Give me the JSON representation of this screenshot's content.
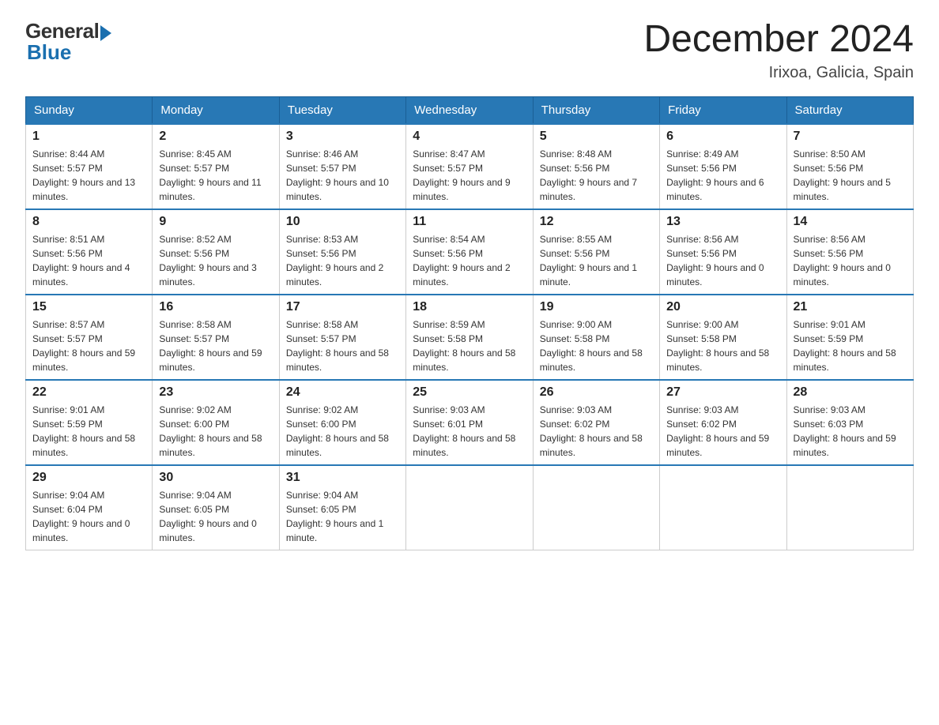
{
  "header": {
    "logo_general": "General",
    "logo_blue": "Blue",
    "main_title": "December 2024",
    "subtitle": "Irixoa, Galicia, Spain"
  },
  "days_of_week": [
    "Sunday",
    "Monday",
    "Tuesday",
    "Wednesday",
    "Thursday",
    "Friday",
    "Saturday"
  ],
  "weeks": [
    [
      {
        "day": "1",
        "sunrise": "8:44 AM",
        "sunset": "5:57 PM",
        "daylight": "9 hours and 13 minutes."
      },
      {
        "day": "2",
        "sunrise": "8:45 AM",
        "sunset": "5:57 PM",
        "daylight": "9 hours and 11 minutes."
      },
      {
        "day": "3",
        "sunrise": "8:46 AM",
        "sunset": "5:57 PM",
        "daylight": "9 hours and 10 minutes."
      },
      {
        "day": "4",
        "sunrise": "8:47 AM",
        "sunset": "5:57 PM",
        "daylight": "9 hours and 9 minutes."
      },
      {
        "day": "5",
        "sunrise": "8:48 AM",
        "sunset": "5:56 PM",
        "daylight": "9 hours and 7 minutes."
      },
      {
        "day": "6",
        "sunrise": "8:49 AM",
        "sunset": "5:56 PM",
        "daylight": "9 hours and 6 minutes."
      },
      {
        "day": "7",
        "sunrise": "8:50 AM",
        "sunset": "5:56 PM",
        "daylight": "9 hours and 5 minutes."
      }
    ],
    [
      {
        "day": "8",
        "sunrise": "8:51 AM",
        "sunset": "5:56 PM",
        "daylight": "9 hours and 4 minutes."
      },
      {
        "day": "9",
        "sunrise": "8:52 AM",
        "sunset": "5:56 PM",
        "daylight": "9 hours and 3 minutes."
      },
      {
        "day": "10",
        "sunrise": "8:53 AM",
        "sunset": "5:56 PM",
        "daylight": "9 hours and 2 minutes."
      },
      {
        "day": "11",
        "sunrise": "8:54 AM",
        "sunset": "5:56 PM",
        "daylight": "9 hours and 2 minutes."
      },
      {
        "day": "12",
        "sunrise": "8:55 AM",
        "sunset": "5:56 PM",
        "daylight": "9 hours and 1 minute."
      },
      {
        "day": "13",
        "sunrise": "8:56 AM",
        "sunset": "5:56 PM",
        "daylight": "9 hours and 0 minutes."
      },
      {
        "day": "14",
        "sunrise": "8:56 AM",
        "sunset": "5:56 PM",
        "daylight": "9 hours and 0 minutes."
      }
    ],
    [
      {
        "day": "15",
        "sunrise": "8:57 AM",
        "sunset": "5:57 PM",
        "daylight": "8 hours and 59 minutes."
      },
      {
        "day": "16",
        "sunrise": "8:58 AM",
        "sunset": "5:57 PM",
        "daylight": "8 hours and 59 minutes."
      },
      {
        "day": "17",
        "sunrise": "8:58 AM",
        "sunset": "5:57 PM",
        "daylight": "8 hours and 58 minutes."
      },
      {
        "day": "18",
        "sunrise": "8:59 AM",
        "sunset": "5:58 PM",
        "daylight": "8 hours and 58 minutes."
      },
      {
        "day": "19",
        "sunrise": "9:00 AM",
        "sunset": "5:58 PM",
        "daylight": "8 hours and 58 minutes."
      },
      {
        "day": "20",
        "sunrise": "9:00 AM",
        "sunset": "5:58 PM",
        "daylight": "8 hours and 58 minutes."
      },
      {
        "day": "21",
        "sunrise": "9:01 AM",
        "sunset": "5:59 PM",
        "daylight": "8 hours and 58 minutes."
      }
    ],
    [
      {
        "day": "22",
        "sunrise": "9:01 AM",
        "sunset": "5:59 PM",
        "daylight": "8 hours and 58 minutes."
      },
      {
        "day": "23",
        "sunrise": "9:02 AM",
        "sunset": "6:00 PM",
        "daylight": "8 hours and 58 minutes."
      },
      {
        "day": "24",
        "sunrise": "9:02 AM",
        "sunset": "6:00 PM",
        "daylight": "8 hours and 58 minutes."
      },
      {
        "day": "25",
        "sunrise": "9:03 AM",
        "sunset": "6:01 PM",
        "daylight": "8 hours and 58 minutes."
      },
      {
        "day": "26",
        "sunrise": "9:03 AM",
        "sunset": "6:02 PM",
        "daylight": "8 hours and 58 minutes."
      },
      {
        "day": "27",
        "sunrise": "9:03 AM",
        "sunset": "6:02 PM",
        "daylight": "8 hours and 59 minutes."
      },
      {
        "day": "28",
        "sunrise": "9:03 AM",
        "sunset": "6:03 PM",
        "daylight": "8 hours and 59 minutes."
      }
    ],
    [
      {
        "day": "29",
        "sunrise": "9:04 AM",
        "sunset": "6:04 PM",
        "daylight": "9 hours and 0 minutes."
      },
      {
        "day": "30",
        "sunrise": "9:04 AM",
        "sunset": "6:05 PM",
        "daylight": "9 hours and 0 minutes."
      },
      {
        "day": "31",
        "sunrise": "9:04 AM",
        "sunset": "6:05 PM",
        "daylight": "9 hours and 1 minute."
      },
      null,
      null,
      null,
      null
    ]
  ],
  "labels": {
    "sunrise_prefix": "Sunrise: ",
    "sunset_prefix": "Sunset: ",
    "daylight_prefix": "Daylight: "
  }
}
